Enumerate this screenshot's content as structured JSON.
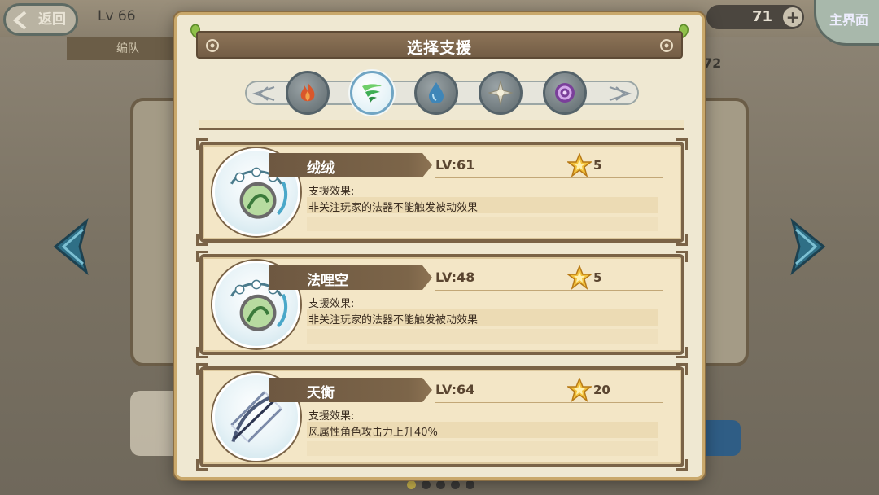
{
  "background": {
    "back_label": "返回",
    "level_label": "Lv 66",
    "team_tab_label": "编队",
    "resource_value": "71",
    "resource_plus": "+",
    "home_label": "主界面",
    "side_number": "72",
    "page_dots": 5,
    "active_page": 0
  },
  "modal": {
    "title": "选择支援",
    "element_tabs": [
      {
        "name": "fire",
        "icon": "fire-element-icon",
        "selected": false
      },
      {
        "name": "wind",
        "icon": "wind-element-icon",
        "selected": true
      },
      {
        "name": "water",
        "icon": "water-element-icon",
        "selected": false
      },
      {
        "name": "light",
        "icon": "light-element-icon",
        "selected": false
      },
      {
        "name": "dark",
        "icon": "dark-element-icon",
        "selected": false
      }
    ],
    "supports": [
      {
        "name": "绒绒",
        "level": "LV:61",
        "stars": "5",
        "effect_label": "支援效果:",
        "effect": "非关注玩家的法器不能触发被动效果",
        "portrait": "lily-orb-artifact"
      },
      {
        "name": "法哩空",
        "level": "LV:48",
        "stars": "5",
        "effect_label": "支援效果:",
        "effect": "非关注玩家的法器不能触发被动效果",
        "portrait": "lily-orb-artifact"
      },
      {
        "name": "天衡",
        "level": "LV:64",
        "stars": "20",
        "effect_label": "支援效果:",
        "effect": "风属性角色攻击力上升40%",
        "portrait": "crossbow-artifact"
      }
    ]
  },
  "colors": {
    "modal_bg": "#efe8d2",
    "banner": "#7c6549",
    "card_bg": "#f3e6c6",
    "selected_tab": "#d7ecf3"
  }
}
